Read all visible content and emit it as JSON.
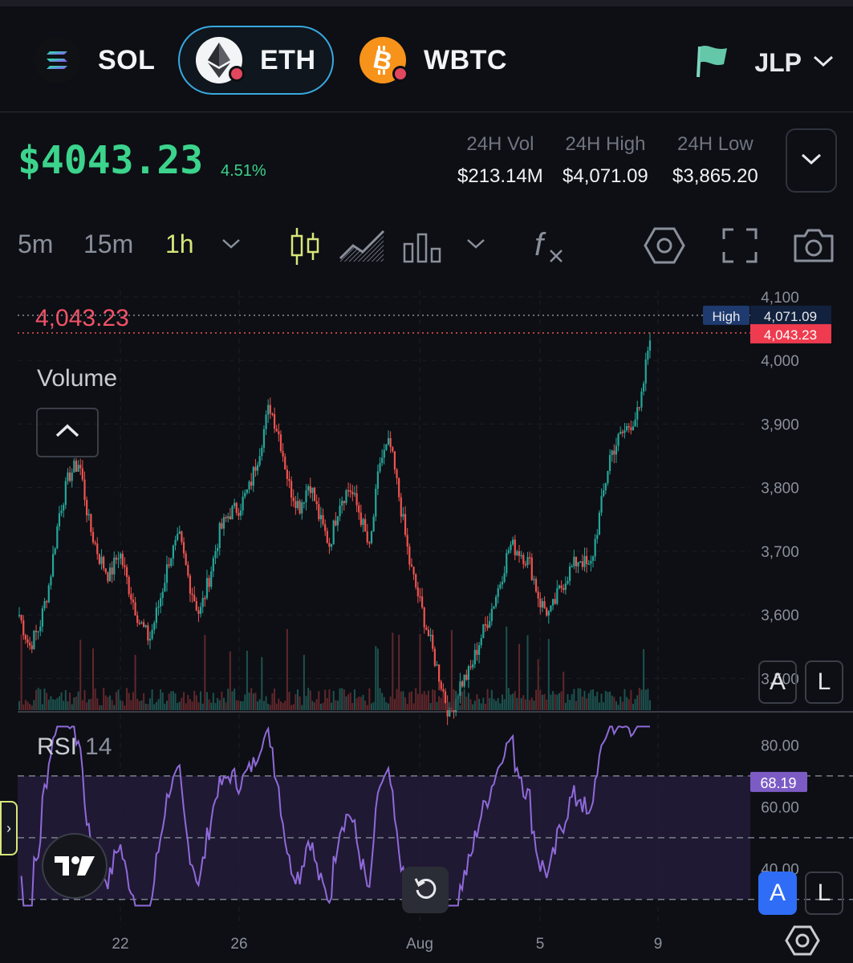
{
  "assets": [
    {
      "symbol": "SOL",
      "icon": "solana-icon"
    },
    {
      "symbol": "ETH",
      "icon": "ethereum-icon",
      "selected": true
    },
    {
      "symbol": "WBTC",
      "icon": "bitcoin-icon"
    }
  ],
  "pool": {
    "label": "JLP",
    "icon": "flag-icon"
  },
  "price": {
    "current": "$4043.23",
    "change": "4.51%"
  },
  "stats": [
    {
      "key": "24H Vol",
      "value": "$213.14M"
    },
    {
      "key": "24H High",
      "value": "$4,071.09"
    },
    {
      "key": "24H Low",
      "value": "$3,865.20"
    }
  ],
  "toolbar": {
    "timeframes": [
      "5m",
      "15m",
      "1h"
    ],
    "active_timeframe": "1h",
    "icons": [
      "chevron-down-icon",
      "candlestick-icon",
      "area-chart-icon",
      "bar-chart-icon",
      "chevron-down-icon",
      "indicators-icon",
      "settings-icon",
      "fullscreen-icon",
      "camera-icon"
    ]
  },
  "chart": {
    "last_price_label": "4,043.23",
    "volume_label": "Volume",
    "rsi_label": "RSI",
    "rsi_period": "14",
    "high_tag": "High",
    "high_value": "4,071.09",
    "last_value_tag": "4,043.23",
    "rsi_value_tag": "68.19",
    "price_ticks": [
      "4,100",
      "4,000",
      "3,900",
      "3,800",
      "3,700",
      "3,600",
      "3,500"
    ],
    "rsi_ticks": [
      "80.00",
      "60.00",
      "40.00"
    ],
    "date_ticks": [
      "22",
      "26",
      "Aug",
      "5",
      "9"
    ],
    "scale_buttons_top": [
      "A",
      "L"
    ],
    "scale_buttons_bottom": [
      "A",
      "L"
    ],
    "colors": {
      "up": "#26a69a",
      "down": "#ef5350",
      "rsi": "#8f6ad9",
      "accent": "#3cd38c"
    }
  },
  "chart_data": {
    "type": "candlestick",
    "price_axis": [
      3450,
      4110
    ],
    "rsi_axis": [
      25,
      90
    ],
    "approx_close_path": [
      3600,
      3550,
      3580,
      3650,
      3760,
      3820,
      3840,
      3740,
      3690,
      3660,
      3700,
      3640,
      3590,
      3560,
      3620,
      3690,
      3720,
      3650,
      3600,
      3660,
      3730,
      3760,
      3770,
      3800,
      3860,
      3930,
      3880,
      3800,
      3770,
      3810,
      3750,
      3710,
      3780,
      3800,
      3760,
      3700,
      3840,
      3870,
      3780,
      3680,
      3620,
      3560,
      3500,
      3440,
      3490,
      3510,
      3560,
      3600,
      3650,
      3710,
      3700,
      3680,
      3620,
      3600,
      3640,
      3670,
      3690,
      3670,
      3760,
      3850,
      3880,
      3900,
      3920,
      4043
    ]
  }
}
